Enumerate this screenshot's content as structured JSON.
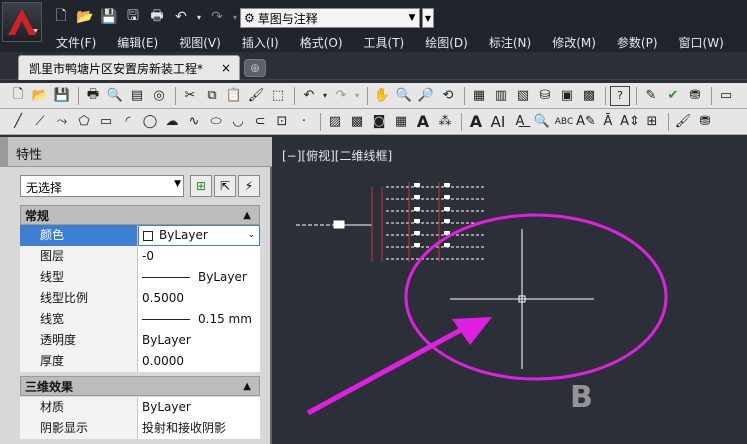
{
  "quick_access": {
    "workspace": "草图与注释"
  },
  "menu": {
    "items": [
      "文件(F)",
      "编辑(E)",
      "视图(V)",
      "插入(I)",
      "格式(O)",
      "工具(T)",
      "绘图(D)",
      "标注(N)",
      "修改(M)",
      "参数(P)",
      "窗口(W)"
    ]
  },
  "document_tab": {
    "title": "凯里市鸭塘片区安置房新装工程*",
    "close": "×"
  },
  "properties": {
    "title": "特性",
    "selection": "无选择",
    "sections": {
      "general": "常规",
      "three_d": "三维效果"
    },
    "general_rows": [
      {
        "name": "颜色",
        "value": "ByLayer"
      },
      {
        "name": "图层",
        "value": "-0"
      },
      {
        "name": "线型",
        "value": "ByLayer"
      },
      {
        "name": "线型比例",
        "value": "0.5000"
      },
      {
        "name": "线宽",
        "value": "0.15 mm"
      },
      {
        "name": "透明度",
        "value": "ByLayer"
      },
      {
        "name": "厚度",
        "value": "0.0000"
      }
    ],
    "three_d_rows": [
      {
        "name": "材质",
        "value": "ByLayer"
      },
      {
        "name": "阴影显示",
        "value": "投射和接收阴影"
      }
    ]
  },
  "viewport": {
    "label": "[−][俯视][二维线框]"
  },
  "colors": {
    "annotation": "#e020e0",
    "canvas_bg": "#2b2f38",
    "selected_row": "#3d7fd3"
  }
}
